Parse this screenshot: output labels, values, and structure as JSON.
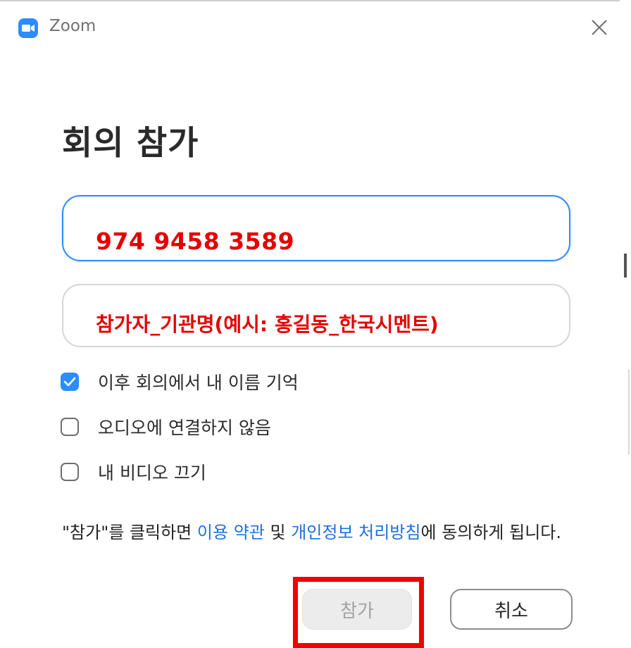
{
  "window": {
    "app_title": "Zoom",
    "accent_color": "#2d8cff",
    "highlight_color": "#f00000"
  },
  "form": {
    "title": "회의 참가",
    "meeting_id_value": "974 9458 3589",
    "name_value": "참가자_기관명(예시: 홍길동_한국시멘트)"
  },
  "options": [
    {
      "label": "이후 회의에서 내 이름 기억",
      "checked": true
    },
    {
      "label": "오디오에 연결하지 않음",
      "checked": false
    },
    {
      "label": "내 비디오 끄기",
      "checked": false
    }
  ],
  "terms": {
    "prefix": "\"참가\"를 클릭하면 ",
    "link1": "이용 약관",
    "middle": " 및 ",
    "link2": "개인정보 처리방침",
    "suffix": "에 동의하게 됩니다."
  },
  "buttons": {
    "join": "참가",
    "cancel": "취소"
  },
  "icons": {
    "app": "zoom-camera-icon",
    "close": "close-icon",
    "check": "checkmark-icon"
  }
}
